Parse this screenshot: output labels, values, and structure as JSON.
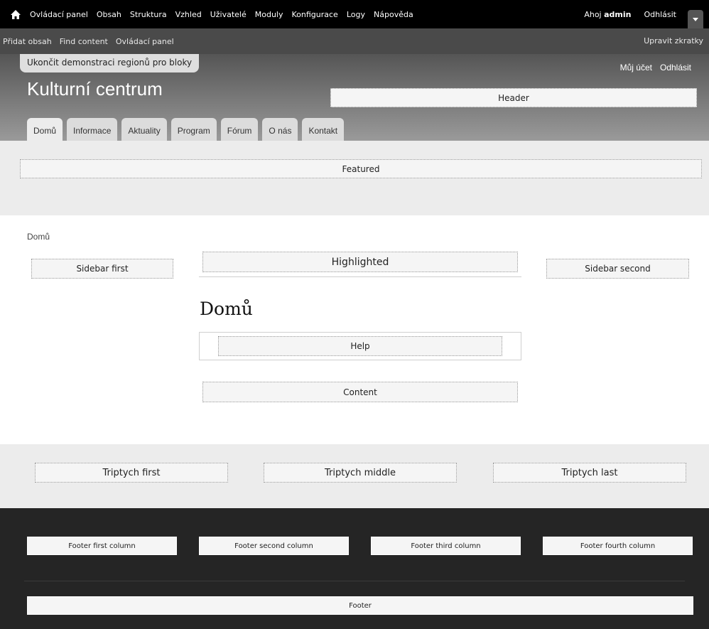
{
  "toolbar": {
    "items": [
      "Ovládací panel",
      "Obsah",
      "Struktura",
      "Vzhled",
      "Uživatelé",
      "Moduly",
      "Konfigurace",
      "Logy",
      "Nápověda"
    ],
    "greeting": "Ahoj ",
    "user": "admin",
    "logout": "Odhlásit"
  },
  "shortcuts": {
    "links": [
      "Přidat obsah",
      "Find content",
      "Ovládací panel"
    ],
    "edit": "Upravit zkratky"
  },
  "header": {
    "demo_exit": "Ukončit demonstraci regionů pro bloky",
    "site_name": "Kulturní centrum",
    "secondary": [
      "Můj účet",
      "Odhlásit"
    ],
    "region": "Header"
  },
  "tabs": [
    "Domů",
    "Informace",
    "Aktuality",
    "Program",
    "Fórum",
    "O nás",
    "Kontakt"
  ],
  "featured": "Featured",
  "main": {
    "breadcrumb": "Domů",
    "sidebar_first": "Sidebar first",
    "highlighted": "Highlighted",
    "sidebar_second": "Sidebar second",
    "page_title": "Domů",
    "help": "Help",
    "content": "Content"
  },
  "triptych": {
    "first": "Triptych first",
    "middle": "Triptych middle",
    "last": "Triptych last"
  },
  "footer": {
    "columns": [
      "Footer first column",
      "Footer second column",
      "Footer third column",
      "Footer fourth column"
    ],
    "region": "Footer"
  }
}
